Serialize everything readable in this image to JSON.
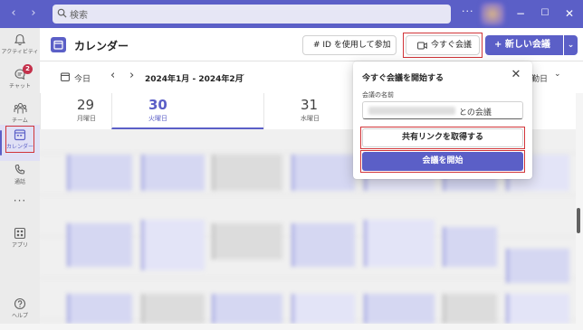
{
  "titlebar": {
    "back_glyph": "‹",
    "forward_glyph": "›",
    "search_placeholder": "検索",
    "more_glyph": "···",
    "minimize_glyph": "−",
    "maximize_glyph": "☐",
    "close_glyph": "✕",
    "bg_color": "#5b5fc7"
  },
  "rail": {
    "items": [
      {
        "label": "アクティビティ",
        "icon": "bell-icon"
      },
      {
        "label": "チャット",
        "icon": "chat-icon",
        "badge": "2"
      },
      {
        "label": "チーム",
        "icon": "teams-icon"
      },
      {
        "label": "カレンダー",
        "icon": "calendar-icon",
        "active": true
      },
      {
        "label": "通話",
        "icon": "phone-icon"
      },
      {
        "label": "アプリ",
        "icon": "apps-icon"
      },
      {
        "label": "ヘルプ",
        "icon": "help-icon"
      }
    ],
    "more_glyph": "···"
  },
  "header": {
    "title": "カレンダー",
    "join_id_label": "#  ID を使用して参加",
    "meet_now_label": "今すぐ会議",
    "new_meeting_label": "+  新しい会議",
    "dropdown_glyph": "⌄"
  },
  "toolbar": {
    "today_label": "今日",
    "prev_glyph": "‹",
    "next_glyph": "›",
    "range_label": "2024年1月 - 2024年2月",
    "range_chevron": "⌄",
    "view_label": "勤日",
    "view_chevron": "⌄"
  },
  "days": [
    {
      "num": "29",
      "name": "月曜日"
    },
    {
      "num": "30",
      "name": "火曜日",
      "today": true
    },
    {
      "num": "31",
      "name": "水曜日"
    }
  ],
  "popup": {
    "title": "今すぐ会議を開始する",
    "close_glyph": "✕",
    "name_label": "会議の名前",
    "name_suffix": "との会議",
    "get_link_label": "共有リンクを取得する",
    "start_label": "会議を開始"
  },
  "colors": {
    "accent": "#5b5fc7",
    "highlight_outline": "#d13438",
    "badge": "#c4314b"
  }
}
